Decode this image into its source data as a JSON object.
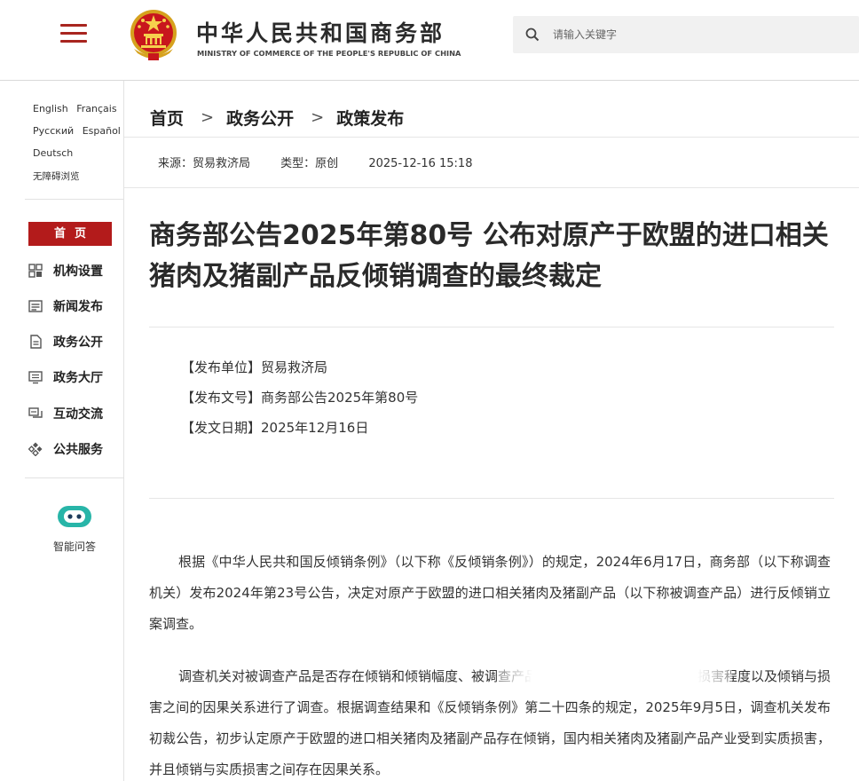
{
  "header": {
    "site_title": "中华人民共和国商务部",
    "site_subtitle": "MINISTRY OF COMMERCE OF THE PEOPLE'S REPUBLIC OF CHINA",
    "search_placeholder": "请输入关键字",
    "accent_color": "#b31b1b"
  },
  "sidebar": {
    "languages_row1": [
      "English",
      "Français"
    ],
    "languages_row2": [
      "Русский",
      "Español"
    ],
    "languages_row3": [
      "Deutsch"
    ],
    "accessibility": "无障碍浏览",
    "home": "首页",
    "nav": [
      {
        "label": "机构设置",
        "icon": "grid-icon"
      },
      {
        "label": "新闻发布",
        "icon": "news-icon"
      },
      {
        "label": "政务公开",
        "icon": "document-icon"
      },
      {
        "label": "政务大厅",
        "icon": "monitor-icon"
      },
      {
        "label": "互动交流",
        "icon": "chat-icon"
      },
      {
        "label": "公共服务",
        "icon": "service-icon"
      }
    ],
    "assistant": "智能问答"
  },
  "breadcrumb": [
    "首页",
    "政务公开",
    "政策发布"
  ],
  "meta": {
    "source": "来源：贸易救济局",
    "type": "类型：原创",
    "datetime": "2025-12-16 15:18"
  },
  "article": {
    "title": "商务部公告2025年第80号 公布对原产于欧盟的进口相关猪肉及猪副产品反倾销调查的最终裁定",
    "issuer": "【发布单位】贸易救济局",
    "doc_no": "【发布文号】商务部公告2025年第80号",
    "date": "【发文日期】2025年12月16日",
    "para1": "根据《中华人民共和国反倾销条例》（以下称《反倾销条例》）的规定，2024年6月17日，商务部（以下称调查机关）发布2024年第23号公告，决定对原产于欧盟的进口相关猪肉及猪副产品（以下称被调查产品）进行反倾销立案调查。",
    "para2": "调查机关对被调查产品是否存在倾销和倾销幅度、被调查产品是否对国内产业造成损害及损害程度以及倾销与损害之间的因果关系进行了调查。根据调查结果和《反倾销条例》第二十四条的规定，2025年9月5日，调查机关发布初裁公告，初步认定原产于欧盟的进口相关猪肉及猪副产品存在倾销，国内相关猪肉及猪副产品产业受到实质损害，并且倾销与实质损害之间存在因果关系。"
  }
}
